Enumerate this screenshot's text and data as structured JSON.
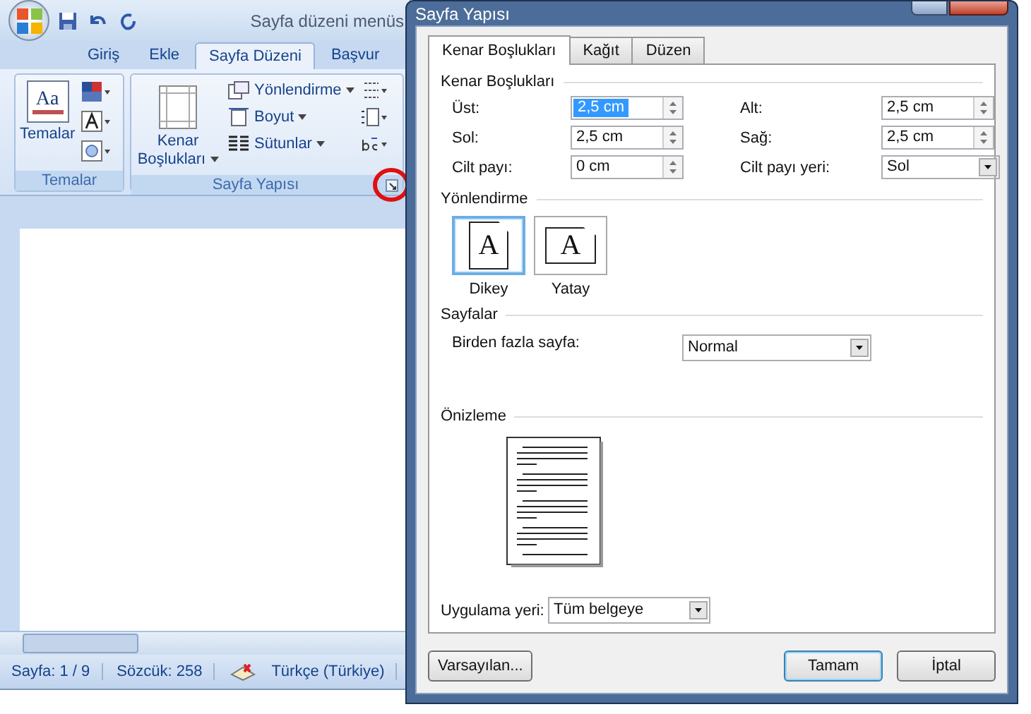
{
  "word": {
    "title": "Sayfa düzeni menüs",
    "tabs": [
      {
        "label": "Giriş",
        "selected": false
      },
      {
        "label": "Ekle",
        "selected": false
      },
      {
        "label": "Sayfa Düzeni",
        "selected": true
      },
      {
        "label": "Başvur",
        "selected": false
      }
    ],
    "themes_group": {
      "icon_text": "Aa",
      "button": "Temalar",
      "label": "Temalar"
    },
    "page_setup_group": {
      "margins_button": "Kenar Boşlukları",
      "commands": [
        {
          "label": "Yönlendirme"
        },
        {
          "label": "Boyut"
        },
        {
          "label": "Sütunlar"
        }
      ],
      "label": "Sayfa Yapısı",
      "launcher_highlighted": true
    },
    "status_bar": {
      "page": "Sayfa: 1 / 9",
      "words": "Sözcük: 258",
      "language": "Türkçe (Türkiye)"
    }
  },
  "dialog": {
    "title": "Sayfa Yapısı",
    "tabs": [
      {
        "label": "Kenar Boşlukları",
        "selected": true
      },
      {
        "label": "Kağıt",
        "selected": false
      },
      {
        "label": "Düzen",
        "selected": false
      }
    ],
    "margins": {
      "heading": "Kenar Boşlukları",
      "fields": [
        {
          "label": "Üst:",
          "value": "2,5 cm",
          "kind": "spin",
          "selected": true
        },
        {
          "label": "Alt:",
          "value": "2,5 cm",
          "kind": "spin",
          "selected": false
        },
        {
          "label": "Sol:",
          "value": "2,5 cm",
          "kind": "spin",
          "selected": false
        },
        {
          "label": "Sağ:",
          "value": "2,5 cm",
          "kind": "spin",
          "selected": false
        },
        {
          "label": "Cilt payı:",
          "value": "0 cm",
          "kind": "spin",
          "selected": false
        },
        {
          "label": "Cilt payı yeri:",
          "value": "Sol",
          "kind": "dropdown",
          "selected": false
        }
      ]
    },
    "orientation": {
      "heading": "Yönlendirme",
      "options": [
        {
          "icon_text": "A",
          "label": "Dikey",
          "kind": "portrait",
          "selected": true
        },
        {
          "icon_text": "A",
          "label": "Yatay",
          "kind": "landscape",
          "selected": false
        }
      ]
    },
    "pages": {
      "heading": "Sayfalar",
      "label": "Birden fazla sayfa:",
      "value": "Normal"
    },
    "preview": {
      "heading": "Önizleme"
    },
    "apply": {
      "label": "Uygulama yeri:",
      "value": "Tüm belgeye"
    },
    "buttons": [
      {
        "label": "Varsayılan...",
        "default": false
      },
      {
        "label": "Tamam",
        "default": true
      },
      {
        "label": "İptal",
        "default": false
      }
    ]
  }
}
